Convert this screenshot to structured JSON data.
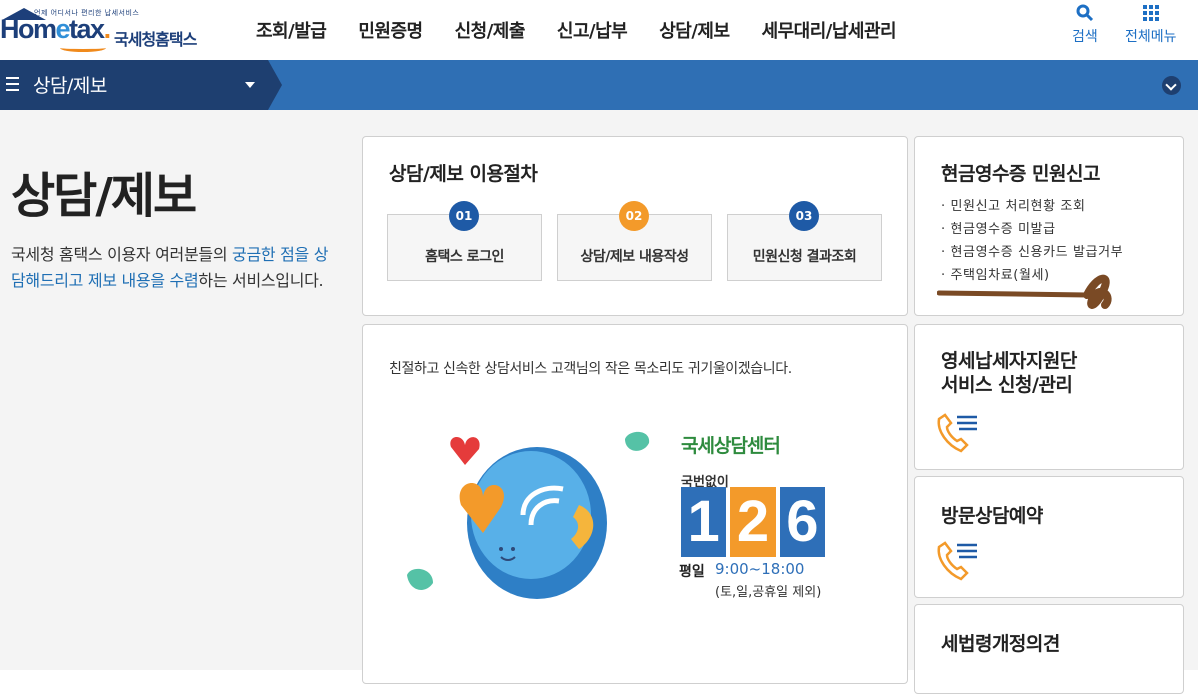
{
  "header": {
    "logo_tagline": "언제 어디서나 편리한 납세서비스",
    "logo_brand": "Hometax",
    "logo_name": "국세청홈택스",
    "menu": [
      "조회/발급",
      "민원증명",
      "신청/제출",
      "신고/납부",
      "상담/제보",
      "세무대리/납세관리"
    ],
    "search_label": "검색",
    "allmenu_label": "전체메뉴"
  },
  "navbar": {
    "title": "상담/제보"
  },
  "page": {
    "title": "상담/제보",
    "desc_part1": "국세청 홈택스 이용자 여러분들의 ",
    "desc_hl1": "궁금한 점을 상담해드리고 제보 내용을 수렴",
    "desc_part2": "하는 서비스입니다."
  },
  "procedure": {
    "title": "상담/제보 이용절차",
    "steps": [
      {
        "num": "01",
        "label": "홈택스 로그인"
      },
      {
        "num": "02",
        "label": "상담/제보 내용작성"
      },
      {
        "num": "03",
        "label": "민원신청 결과조회"
      }
    ]
  },
  "receipt": {
    "title": "현금영수증 민원신고",
    "items": [
      "민원신고 처리현황 조회",
      "현금영수증 미발급",
      "현금영수증 신용카드 발급거부",
      "주택임차료(월세)"
    ]
  },
  "center": {
    "intro": "친절하고 신속한 상담서비스 고객님의 작은 목소리도 귀기울이겠습니다.",
    "name": "국세상담센터",
    "no_area": "국번없이",
    "number": "126",
    "hours_label": "평일",
    "hours": "9:00~18:00",
    "closed": "(토,일,공휴일 제외)"
  },
  "side_cards": [
    {
      "title_line1": "영세납세자지원단",
      "title_line2": "서비스 신청/관리"
    },
    {
      "title_line1": "방문상담예약"
    },
    {
      "title_line1": "세법령개정의견"
    }
  ],
  "colors": {
    "navy": "#1e3f70",
    "blue": "#2f6fb4",
    "orange": "#f39a2a",
    "marker": "#7a4a25"
  }
}
